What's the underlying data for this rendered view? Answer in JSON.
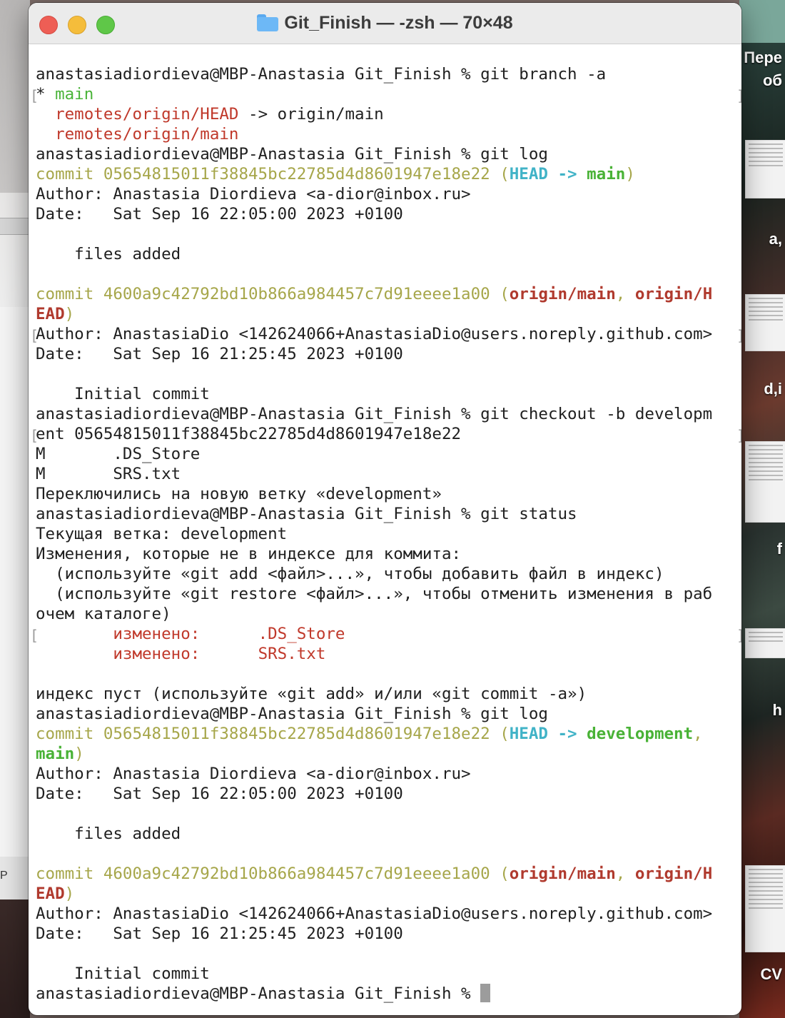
{
  "window": {
    "title": "Git_Finish — -zsh — 70×48"
  },
  "desktop": {
    "right_labels": [
      "Пере",
      "об",
      "a,",
      "d,i",
      "f",
      "h",
      "CV"
    ],
    "left_label": "P"
  },
  "terminal": {
    "lines": [
      {
        "segs": [
          {
            "t": "anastasiadiordieva@MBP-Anastasia Git_Finish % git branch -a"
          }
        ]
      },
      {
        "segs": [
          {
            "t": "* "
          },
          {
            "t": "main",
            "c": "g"
          }
        ],
        "marks": true
      },
      {
        "segs": [
          {
            "t": "  "
          },
          {
            "t": "remotes/origin/HEAD",
            "c": "r"
          },
          {
            "t": " -> origin/main"
          }
        ]
      },
      {
        "segs": [
          {
            "t": "  "
          },
          {
            "t": "remotes/origin/main",
            "c": "r"
          }
        ]
      },
      {
        "segs": [
          {
            "t": "anastasiadiordieva@MBP-Anastasia Git_Finish % git log"
          }
        ]
      },
      {
        "segs": [
          {
            "t": "commit 05654815011f38845bc22785d4d8601947e18e22 (",
            "c": "y"
          },
          {
            "t": "HEAD -> ",
            "c": "cb"
          },
          {
            "t": "main",
            "c": "gb"
          },
          {
            "t": ")",
            "c": "y"
          }
        ]
      },
      {
        "segs": [
          {
            "t": "Author: Anastasia Diordieva <a-dior@inbox.ru>"
          }
        ]
      },
      {
        "segs": [
          {
            "t": "Date:   Sat Sep 16 22:05:00 2023 +0100"
          }
        ]
      },
      {
        "segs": [
          {
            "t": ""
          }
        ]
      },
      {
        "segs": [
          {
            "t": "    files added"
          }
        ]
      },
      {
        "segs": [
          {
            "t": ""
          }
        ]
      },
      {
        "segs": [
          {
            "t": "commit 4600a9c42792bd10b866a984457c7d91eeee1a00 (",
            "c": "y"
          },
          {
            "t": "origin/main",
            "c": "rb"
          },
          {
            "t": ", ",
            "c": "y"
          },
          {
            "t": "origin/H",
            "c": "rb"
          }
        ]
      },
      {
        "segs": [
          {
            "t": "EAD",
            "c": "rb"
          },
          {
            "t": ")",
            "c": "y"
          }
        ]
      },
      {
        "segs": [
          {
            "t": "Author: AnastasiaDio <142624066+AnastasiaDio@users.noreply.github.com>"
          }
        ],
        "marks": true
      },
      {
        "segs": [
          {
            "t": "Date:   Sat Sep 16 21:25:45 2023 +0100"
          }
        ]
      },
      {
        "segs": [
          {
            "t": ""
          }
        ]
      },
      {
        "segs": [
          {
            "t": "    Initial commit"
          }
        ]
      },
      {
        "segs": [
          {
            "t": "anastasiadiordieva@MBP-Anastasia Git_Finish % git checkout -b developm"
          }
        ]
      },
      {
        "segs": [
          {
            "t": "ent 05654815011f38845bc22785d4d8601947e18e22"
          }
        ],
        "marks": true
      },
      {
        "segs": [
          {
            "t": "M       .DS_Store"
          }
        ]
      },
      {
        "segs": [
          {
            "t": "M       SRS.txt"
          }
        ]
      },
      {
        "segs": [
          {
            "t": "Переключились на новую ветку «development»"
          }
        ]
      },
      {
        "segs": [
          {
            "t": "anastasiadiordieva@MBP-Anastasia Git_Finish % git status"
          }
        ]
      },
      {
        "segs": [
          {
            "t": "Текущая ветка: development"
          }
        ]
      },
      {
        "segs": [
          {
            "t": "Изменения, которые не в индексе для коммита:"
          }
        ]
      },
      {
        "segs": [
          {
            "t": "  (используйте «git add <файл>...», чтобы добавить файл в индекс)"
          }
        ]
      },
      {
        "segs": [
          {
            "t": "  (используйте «git restore <файл>...», чтобы отменить изменения в раб"
          }
        ]
      },
      {
        "segs": [
          {
            "t": "очем каталоге)"
          }
        ]
      },
      {
        "segs": [
          {
            "t": "        "
          },
          {
            "t": "изменено:      .DS_Store",
            "c": "r"
          }
        ],
        "marks": true
      },
      {
        "segs": [
          {
            "t": "        "
          },
          {
            "t": "изменено:      SRS.txt",
            "c": "r"
          }
        ]
      },
      {
        "segs": [
          {
            "t": ""
          }
        ]
      },
      {
        "segs": [
          {
            "t": "индекс пуст (используйте «git add» и/или «git commit -a»)"
          }
        ]
      },
      {
        "segs": [
          {
            "t": "anastasiadiordieva@MBP-Anastasia Git_Finish % git log"
          }
        ]
      },
      {
        "segs": [
          {
            "t": "commit 05654815011f38845bc22785d4d8601947e18e22 (",
            "c": "y"
          },
          {
            "t": "HEAD -> ",
            "c": "cb"
          },
          {
            "t": "development",
            "c": "gb"
          },
          {
            "t": ",",
            "c": "y"
          }
        ]
      },
      {
        "segs": [
          {
            "t": "main",
            "c": "gb"
          },
          {
            "t": ")",
            "c": "y"
          }
        ]
      },
      {
        "segs": [
          {
            "t": "Author: Anastasia Diordieva <a-dior@inbox.ru>"
          }
        ]
      },
      {
        "segs": [
          {
            "t": "Date:   Sat Sep 16 22:05:00 2023 +0100"
          }
        ]
      },
      {
        "segs": [
          {
            "t": ""
          }
        ]
      },
      {
        "segs": [
          {
            "t": "    files added"
          }
        ]
      },
      {
        "segs": [
          {
            "t": ""
          }
        ]
      },
      {
        "segs": [
          {
            "t": "commit 4600a9c42792bd10b866a984457c7d91eeee1a00 (",
            "c": "y"
          },
          {
            "t": "origin/main",
            "c": "rb"
          },
          {
            "t": ", ",
            "c": "y"
          },
          {
            "t": "origin/H",
            "c": "rb"
          }
        ]
      },
      {
        "segs": [
          {
            "t": "EAD",
            "c": "rb"
          },
          {
            "t": ")",
            "c": "y"
          }
        ]
      },
      {
        "segs": [
          {
            "t": "Author: AnastasiaDio <142624066+AnastasiaDio@users.noreply.github.com>"
          }
        ]
      },
      {
        "segs": [
          {
            "t": "Date:   Sat Sep 16 21:25:45 2023 +0100"
          }
        ]
      },
      {
        "segs": [
          {
            "t": ""
          }
        ]
      },
      {
        "segs": [
          {
            "t": "    Initial commit"
          }
        ]
      },
      {
        "segs": [
          {
            "t": "anastasiadiordieva@MBP-Anastasia Git_Finish % "
          }
        ],
        "cursor": true
      }
    ]
  },
  "colors": {
    "commit_hash": "#a6a64a",
    "branch_local": "#4bb43a",
    "head_pointer": "#41b3c7",
    "branch_remote": "#b03a2e",
    "modified": "#c0392b"
  }
}
